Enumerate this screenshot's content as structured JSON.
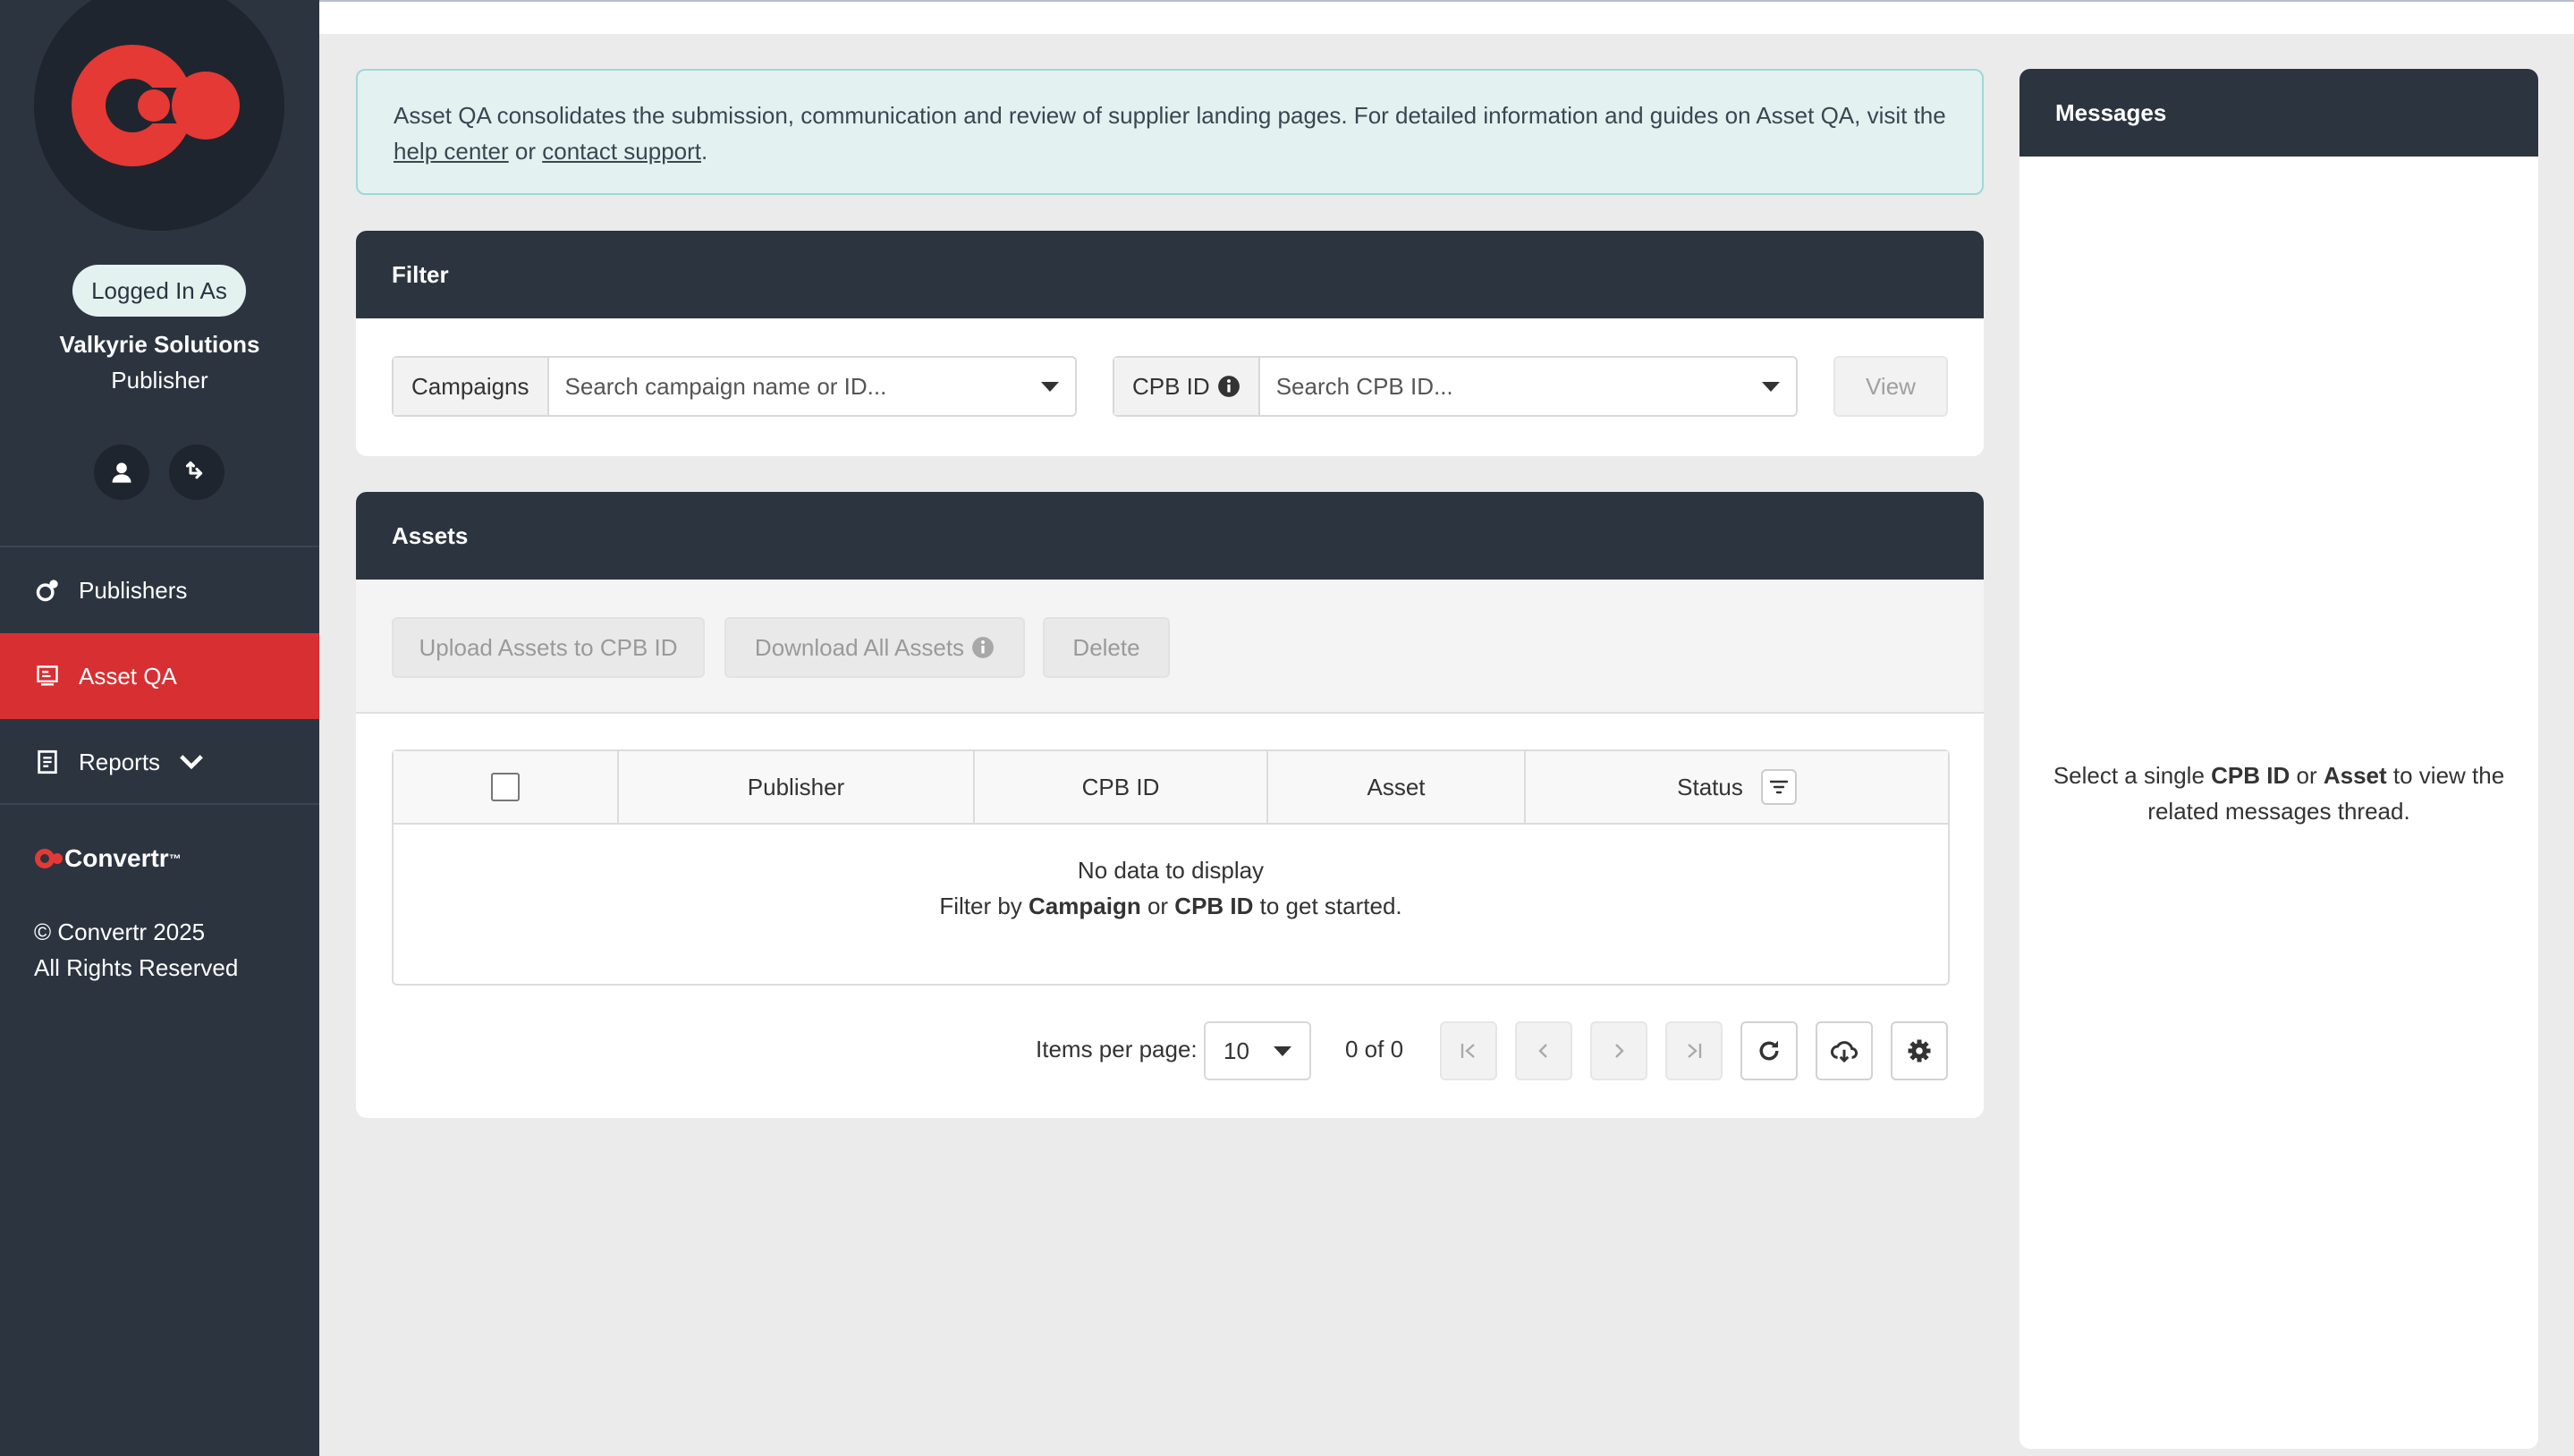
{
  "sidebar": {
    "logged_in_label": "Logged In As",
    "company": "Valkyrie Solutions",
    "role": "Publisher",
    "nav": [
      {
        "label": "Publishers",
        "icon": "publisher-icon"
      },
      {
        "label": "Asset QA",
        "icon": "asset-qa-icon",
        "active": true
      },
      {
        "label": "Reports",
        "icon": "report-icon"
      }
    ],
    "brand": "Convertr",
    "brand_mark": "™",
    "copyright_line1": "© Convertr 2025",
    "copyright_line2": "All Rights Reserved"
  },
  "info": {
    "text_before": "Asset QA consolidates the submission, communication and review of supplier landing pages. For detailed information and guides on Asset QA, visit the ",
    "help_link": "help center",
    "or": " or ",
    "contact_link": "contact support",
    "period": "."
  },
  "filter": {
    "title": "Filter",
    "campaigns_label": "Campaigns",
    "campaigns_placeholder": "Search campaign name or ID...",
    "cpb_label": "CPB ID",
    "cpb_placeholder": "Search CPB ID...",
    "view_label": "View"
  },
  "assets": {
    "title": "Assets",
    "upload_label": "Upload Assets to CPB ID",
    "download_label": "Download All Assets",
    "delete_label": "Delete",
    "columns": [
      "Publisher",
      "CPB ID",
      "Asset",
      "Status"
    ],
    "empty_line1": "No data to display",
    "empty_filter_by": "Filter by ",
    "empty_campaign": "Campaign",
    "empty_or": " or ",
    "empty_cpb": "CPB ID",
    "empty_suffix": " to get started."
  },
  "pager": {
    "items_per_page_label": "Items per page:",
    "page_size": "10",
    "range": "0 of 0"
  },
  "messages": {
    "title": "Messages",
    "body_prefix": "Select a single ",
    "body_cpb": "CPB ID",
    "body_or": " or ",
    "body_asset": "Asset",
    "body_suffix": " to view the related messages thread."
  },
  "colors": {
    "sidebar_bg": "#2c3440",
    "accent_red": "#d82f32",
    "info_bg": "#e3f2f1"
  }
}
